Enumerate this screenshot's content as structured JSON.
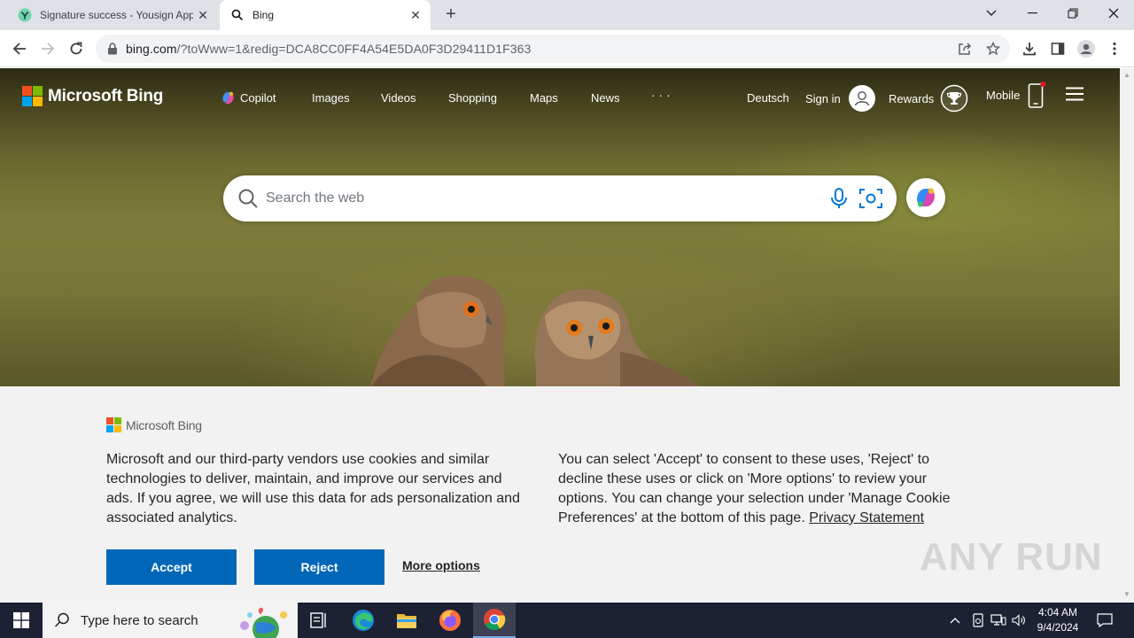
{
  "browser": {
    "tabs": [
      {
        "title": "Signature success - Yousign App",
        "active": false
      },
      {
        "title": "Bing",
        "active": true
      }
    ],
    "new_tab": "+",
    "url_main": "bing.com",
    "url_rest": "/?toWww=1&redig=DCA8CC0FF4A54E5DA0F3D29411D1F363"
  },
  "bing": {
    "logo_text": "Microsoft Bing",
    "nav": {
      "copilot": "Copilot",
      "images": "Images",
      "videos": "Videos",
      "shopping": "Shopping",
      "maps": "Maps",
      "news": "News",
      "more": "· · ·",
      "language": "Deutsch",
      "sign_in": "Sign in",
      "rewards": "Rewards",
      "mobile": "Mobile"
    },
    "search_placeholder": "Search the web"
  },
  "consent": {
    "brand": "Microsoft Bing",
    "paragraph_left": "Microsoft and our third-party vendors use cookies and similar technologies to deliver, maintain, and improve our services and ads. If you agree, we will use this data for ads personalization and associated analytics.",
    "paragraph_right": "You can select 'Accept' to consent to these uses, 'Reject' to decline these uses or click on 'More options' to review your options. You can change your selection under 'Manage Cookie Preferences' at the bottom of this page. ",
    "privacy_link": "Privacy Statement",
    "accept": "Accept",
    "reject": "Reject",
    "more_options": "More options"
  },
  "watermark": "ANY RUN",
  "taskbar": {
    "search_placeholder": "Type here to search",
    "time": "4:04 AM",
    "date": "9/4/2024"
  },
  "colors": {
    "accent_blue": "#0067b8",
    "taskbar": "#1c2133",
    "ms_red": "#f25022",
    "ms_green": "#7fba00",
    "ms_blue": "#00a4ef",
    "ms_yellow": "#ffb900"
  }
}
